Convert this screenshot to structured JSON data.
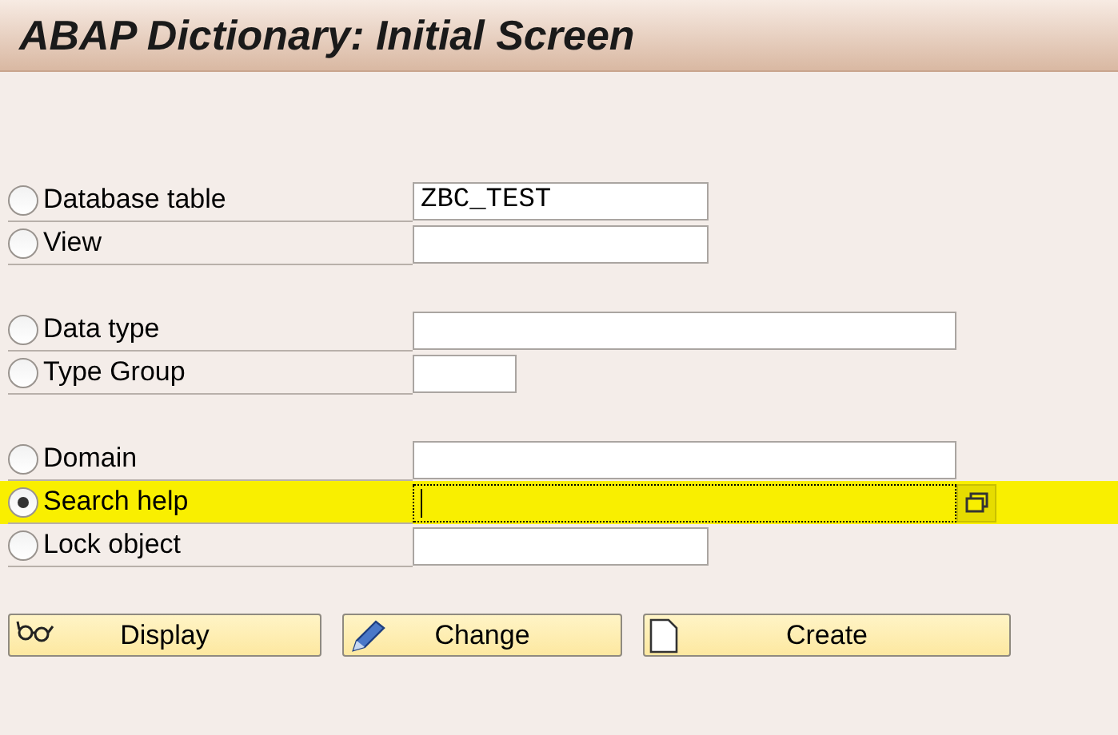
{
  "window": {
    "title": "ABAP Dictionary: Initial Screen"
  },
  "groups": [
    {
      "options": [
        {
          "label": "Database table",
          "selected": false,
          "value": "ZBC_TEST",
          "kind": "short",
          "focused": false
        },
        {
          "label": "View",
          "selected": false,
          "kind": "short",
          "focused": false
        }
      ]
    },
    {
      "options": [
        {
          "label": "Data type",
          "selected": false,
          "kind": "long",
          "focused": false
        },
        {
          "label": "Type Group",
          "selected": false,
          "kind": "tiny",
          "focused": false
        }
      ]
    },
    {
      "options": [
        {
          "label": "Domain",
          "selected": false,
          "kind": "long",
          "focused": false
        },
        {
          "label": "Search help",
          "selected": true,
          "kind": "long",
          "focused": true
        },
        {
          "label": "Lock object",
          "selected": false,
          "kind": "short",
          "focused": false
        }
      ]
    }
  ],
  "buttons": [
    {
      "label": "Display",
      "kind": "display"
    },
    {
      "label": "Change",
      "kind": "change"
    },
    {
      "label": "Create",
      "kind": "create"
    }
  ]
}
